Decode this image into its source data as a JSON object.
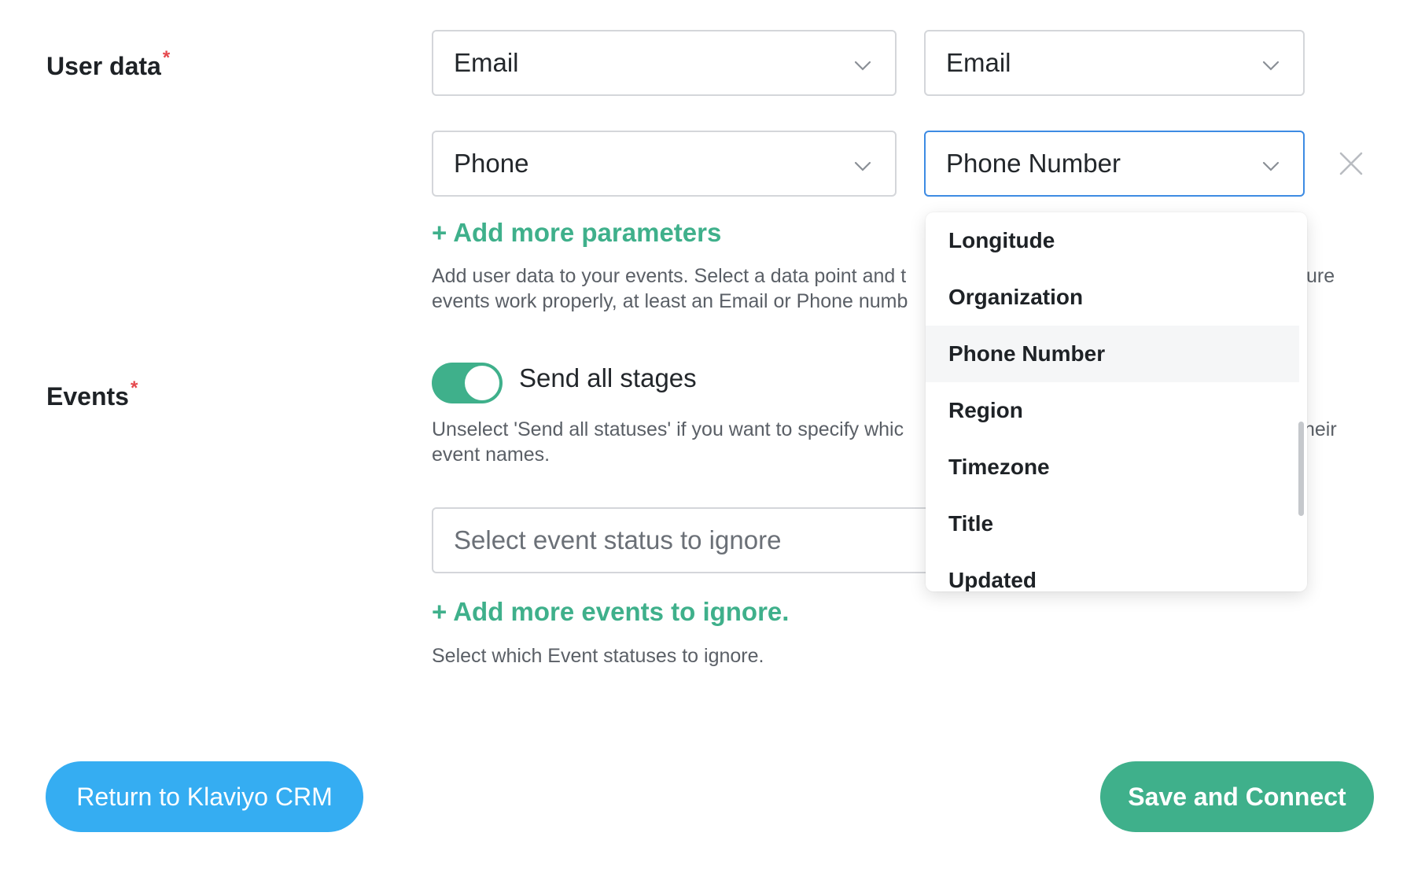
{
  "user_data": {
    "label": "User data",
    "required_mark": "*",
    "rows": [
      {
        "source": "Email",
        "target": "Email"
      },
      {
        "source": "Phone",
        "target": "Phone Number"
      }
    ],
    "add_link": "+ Add more parameters",
    "help_line1": "Add user data to your events. Select a data point and t",
    "help_line1_tail": "ure",
    "help_line2": "events work properly, at least an Email or Phone numb"
  },
  "events": {
    "label": "Events",
    "required_mark": "*",
    "toggle_label": "Send all stages",
    "toggle_on": true,
    "help_line1": "Unselect 'Send all statuses' if you want to specify whic",
    "help_line1_tail": "heir",
    "help_line2": "event names.",
    "ignore_placeholder": "Select event status to ignore",
    "add_link": "+ Add more events to ignore.",
    "ignore_help": "Select which Event statuses to ignore."
  },
  "dropdown": {
    "options": [
      "Longitude",
      "Organization",
      "Phone Number",
      "Region",
      "Timezone",
      "Title",
      "Updated"
    ],
    "selected": "Phone Number"
  },
  "footer": {
    "return_label": "Return to Klaviyo CRM",
    "save_label": "Save and Connect"
  },
  "colors": {
    "accent_green": "#3fb08b",
    "return_blue": "#35adf2",
    "active_border": "#3d8be3",
    "required_red": "#e5484d"
  }
}
